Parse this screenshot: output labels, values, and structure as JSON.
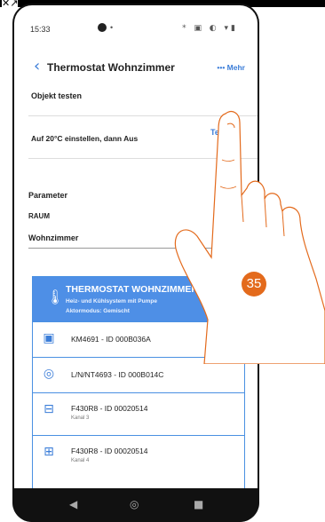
{
  "overlay": {
    "corner_icon": "close-external-icon",
    "marker_number": "35"
  },
  "status_bar": {
    "time": "15:33",
    "notification_dot": "•",
    "system_icons": "* ▣ ◐ ▾▮"
  },
  "header": {
    "back_icon": "chevron-left-icon",
    "title": "Thermostat Wohnzimmer",
    "more_label": "••• Mehr"
  },
  "test_section": {
    "heading": "Objekt testen",
    "action_text": "Auf 20°C einstellen, dann Aus",
    "test_link": "Test"
  },
  "params": {
    "heading": "Parameter",
    "room_label": "RAUM",
    "room_value": "Wohnzimmer"
  },
  "card": {
    "title": "THERMOSTAT WOHNZIMMER",
    "subtitle_1": "Heiz- und Kühlsystem mit Pumpe",
    "subtitle_2": "Aktormodus: Gemischt",
    "header_icon": "thermometer-icon",
    "devices": [
      {
        "icon": "keypad-icon",
        "label": "KM4691 - ID 000B036A",
        "sub": ""
      },
      {
        "icon": "probe-icon",
        "label": "L/N/NT4693 - ID 000B014C",
        "sub": ""
      },
      {
        "icon": "actuator-icon",
        "label": "F430R8 - ID 00020514",
        "sub": "Kanal 3"
      },
      {
        "icon": "valve-icon",
        "label": "F430R8 - ID 00020514",
        "sub": "Kanal 4"
      }
    ]
  },
  "nav_buttons": {
    "back": "◀",
    "home": "◎",
    "recents": "■"
  },
  "colors": {
    "accent": "#3b7dd8",
    "card_header": "#4e8fe6",
    "marker": "#e36a1c"
  }
}
